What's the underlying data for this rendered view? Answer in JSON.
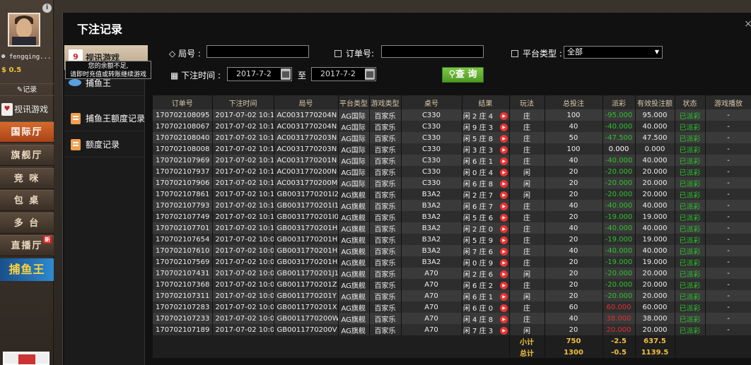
{
  "sidebar": {
    "username": "fengqing...",
    "balance": "0.5",
    "record_label": "记录",
    "video_label": "视讯游戏",
    "items": [
      {
        "label": "国际厅",
        "active": true
      },
      {
        "label": "旗舰厅"
      },
      {
        "label": "竞 咪"
      },
      {
        "label": "包 桌"
      },
      {
        "label": "多 台"
      },
      {
        "label": "直播厅",
        "badge": "新"
      }
    ],
    "banner_label": "捕鱼王"
  },
  "modal": {
    "title": "下注记录",
    "tooltip_line1": "您的余额不足,",
    "tooltip_line2": "请即时充值或转账继续游戏",
    "menu": [
      {
        "label": "视讯游戏"
      },
      {
        "label": "捕鱼王"
      },
      {
        "label": "捕鱼王额度记录"
      },
      {
        "label": "额度记录"
      }
    ]
  },
  "filters": {
    "round_label": "局号 :",
    "order_label": "订单号:",
    "platform_label": "平台类型 :",
    "platform_value": "全部",
    "time_label": "下注时间 :",
    "date_from": "2017-7-2",
    "to_label": "至",
    "date_to": "2017-7-2",
    "query_label": "查 询"
  },
  "table": {
    "headers": [
      "订单号",
      "下注时间",
      "局号",
      "平台类型",
      "游戏类型",
      "桌号",
      "结果",
      "玩法",
      "总投注",
      "派彩",
      "有效投注额",
      "状态",
      "游戏播放"
    ],
    "rows": [
      [
        "170702108095",
        "2017-07-02 10:1",
        "AC0031770204N",
        "AG国际",
        "百家乐",
        "C330",
        "闲 2 庄 4",
        "庄",
        "100",
        "-95.000",
        "95.000",
        "已派彩",
        "-"
      ],
      [
        "170702108067",
        "2017-07-02 10:1",
        "AC0031770204N",
        "AG国际",
        "百家乐",
        "C330",
        "闲 9 庄 3",
        "庄",
        "40",
        "-40.000",
        "40.000",
        "已派彩",
        "-"
      ],
      [
        "170702108040",
        "2017-07-02 10:1",
        "AC0031770203N",
        "AG国际",
        "百家乐",
        "C330",
        "闲 5 庄 8",
        "庄",
        "50",
        "-47.500",
        "47.500",
        "已派彩",
        "-"
      ],
      [
        "170702108008",
        "2017-07-02 10:1",
        "AC0031770203N",
        "AG国际",
        "百家乐",
        "C330",
        "闲 3 庄 3",
        "庄",
        "100",
        "0.000",
        "0.000",
        "已派彩",
        "-"
      ],
      [
        "170702107969",
        "2017-07-02 10:1",
        "AC0031770201N",
        "AG国际",
        "百家乐",
        "C330",
        "闲 6 庄 1",
        "庄",
        "40",
        "-40.000",
        "40.000",
        "已派彩",
        "-"
      ],
      [
        "170702107937",
        "2017-07-02 10:1",
        "AC0031770200N",
        "AG国际",
        "百家乐",
        "C330",
        "闲 0 庄 4",
        "闲",
        "20",
        "-20.000",
        "20.000",
        "已派彩",
        "-"
      ],
      [
        "170702107906",
        "2017-07-02 10:1",
        "AC0031770200M",
        "AG国际",
        "百家乐",
        "C330",
        "闲 6 庄 8",
        "闲",
        "20",
        "-20.000",
        "20.000",
        "已派彩",
        "-"
      ],
      [
        "170702107861",
        "2017-07-02 10:1",
        "GB0031770201I2",
        "AG旗舰",
        "百家乐",
        "B3A2",
        "闲 2 庄 7",
        "闲",
        "20",
        "-20.000",
        "20.000",
        "已派彩",
        "-"
      ],
      [
        "170702107793",
        "2017-07-02 10:1",
        "GB0031770201I1",
        "AG旗舰",
        "百家乐",
        "B3A2",
        "闲 6 庄 7",
        "庄",
        "40",
        "-40.000",
        "40.000",
        "已派彩",
        "-"
      ],
      [
        "170702107749",
        "2017-07-02 10:1",
        "GB0031770201I0",
        "AG旗舰",
        "百家乐",
        "B3A2",
        "闲 5 庄 6",
        "庄",
        "20",
        "-19.000",
        "19.000",
        "已派彩",
        "-"
      ],
      [
        "170702107701",
        "2017-07-02 10:1",
        "GB0031770201H",
        "AG旗舰",
        "百家乐",
        "B3A2",
        "闲 2 庄 0",
        "庄",
        "40",
        "-40.000",
        "40.000",
        "已派彩",
        "-"
      ],
      [
        "170702107654",
        "2017-07-02 10:0",
        "GB0031770201H",
        "AG旗舰",
        "百家乐",
        "B3A2",
        "闲 5 庄 9",
        "庄",
        "20",
        "-19.000",
        "19.000",
        "已派彩",
        "-"
      ],
      [
        "170702107610",
        "2017-07-02 10:0",
        "GB0031770201H",
        "AG旗舰",
        "百家乐",
        "B3A2",
        "闲 7 庄 6",
        "庄",
        "40",
        "-40.000",
        "40.000",
        "已派彩",
        "-"
      ],
      [
        "170702107569",
        "2017-07-02 10:0",
        "GB0031770201H",
        "AG旗舰",
        "百家乐",
        "B3A2",
        "闲 0 庄 9",
        "庄",
        "20",
        "-19.000",
        "19.000",
        "已派彩",
        "-"
      ],
      [
        "170702107431",
        "2017-07-02 10:0",
        "GB0011770201J1",
        "AG旗舰",
        "百家乐",
        "A70",
        "闲 2 庄 6",
        "闲",
        "20",
        "-20.000",
        "20.000",
        "已派彩",
        "-"
      ],
      [
        "170702107368",
        "2017-07-02 10:0",
        "GB0011770201Z",
        "AG旗舰",
        "百家乐",
        "A70",
        "闲 6 庄 2",
        "庄",
        "20",
        "-20.000",
        "20.000",
        "已派彩",
        "-"
      ],
      [
        "170702107311",
        "2017-07-02 10:0",
        "GB0011770201Y",
        "AG旗舰",
        "百家乐",
        "A70",
        "闲 6 庄 1",
        "闲",
        "20",
        "-20.000",
        "20.000",
        "已派彩",
        "-"
      ],
      [
        "170702107283",
        "2017-07-02 10:0",
        "GB0011770201X",
        "AG旗舰",
        "百家乐",
        "A70",
        "闲 6 庄 0",
        "庄",
        "60",
        "60.000",
        "60.000",
        "已派彩",
        "-"
      ],
      [
        "170702107233",
        "2017-07-02 10:0",
        "GB0011770200W",
        "AG旗舰",
        "百家乐",
        "A70",
        "闲 4 庄 8",
        "庄",
        "40",
        "38.000",
        "38.000",
        "已派彩",
        "-"
      ],
      [
        "170702107189",
        "2017-07-02 10:0",
        "GB0011770200V",
        "AG旗舰",
        "百家乐",
        "A70",
        "闲 7 庄 3",
        "闲",
        "20",
        "20.000",
        "20.000",
        "已派彩",
        "-"
      ]
    ],
    "subtotal": {
      "label": "小计",
      "total": "750",
      "payout": "-2.5",
      "valid": "637.5"
    },
    "grand_total": {
      "label": "总计",
      "total": "1300",
      "payout": "-0.5",
      "valid": "1139.5"
    }
  },
  "colors": {
    "positive": "#2ec02e",
    "negative": "#e03030",
    "accent": "#d86a2a"
  }
}
